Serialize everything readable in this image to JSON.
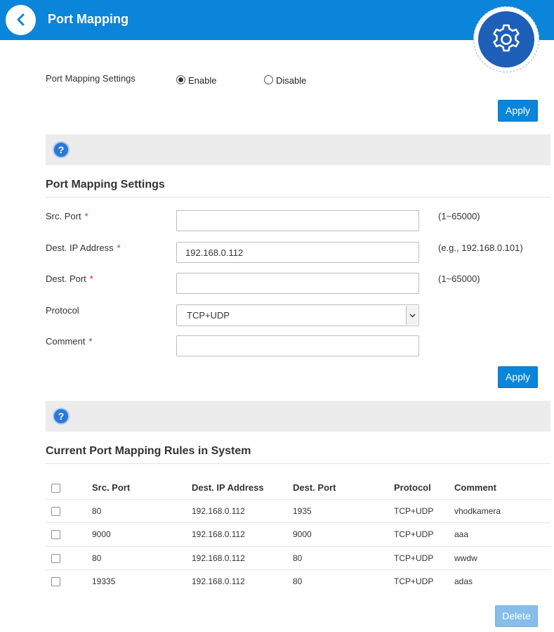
{
  "header": {
    "title": "Port Mapping",
    "back_icon": "chevron-left-icon",
    "settings_icon": "gear-icon"
  },
  "global_settings": {
    "label": "Port Mapping Settings",
    "options": [
      {
        "label": "Enable",
        "checked": true
      },
      {
        "label": "Disable",
        "checked": false
      }
    ],
    "apply_label": "Apply"
  },
  "form": {
    "title": "Port Mapping Settings",
    "help_icon": "?",
    "src_port": {
      "label": "Src. Port",
      "required": "*",
      "value": "",
      "hint": "(1~65000)"
    },
    "dest_ip": {
      "label": "Dest. IP Address",
      "required": "*",
      "value": "192.168.0.112",
      "hint": "(e.g., 192.168.0.101)"
    },
    "dest_port": {
      "label": "Dest. Port",
      "required": "*",
      "value": "",
      "hint": "(1~65000)"
    },
    "protocol": {
      "label": "Protocol",
      "value": "TCP+UDP"
    },
    "comment": {
      "label": "Comment",
      "required": "*",
      "value": ""
    },
    "apply_label": "Apply"
  },
  "rules": {
    "title": "Current Port Mapping Rules in System",
    "help_icon": "?",
    "columns": [
      "Src. Port",
      "Dest. IP Address",
      "Dest. Port",
      "Protocol",
      "Comment"
    ],
    "rows": [
      [
        "80",
        "192.168.0.112",
        "1935",
        "TCP+UDP",
        "vhodkamera"
      ],
      [
        "9000",
        "192.168.0.112",
        "9000",
        "TCP+UDP",
        "aaa"
      ],
      [
        "80",
        "192.168.0.112",
        "80",
        "TCP+UDP",
        "wwdw"
      ],
      [
        "19335",
        "192.168.0.112",
        "80",
        "TCP+UDP",
        "adas"
      ]
    ],
    "delete_label": "Delete"
  },
  "colors": {
    "header": "#0a85d9",
    "button": "#0a85d9",
    "button_disabled": "#86bde9",
    "required": "#d9211c"
  }
}
